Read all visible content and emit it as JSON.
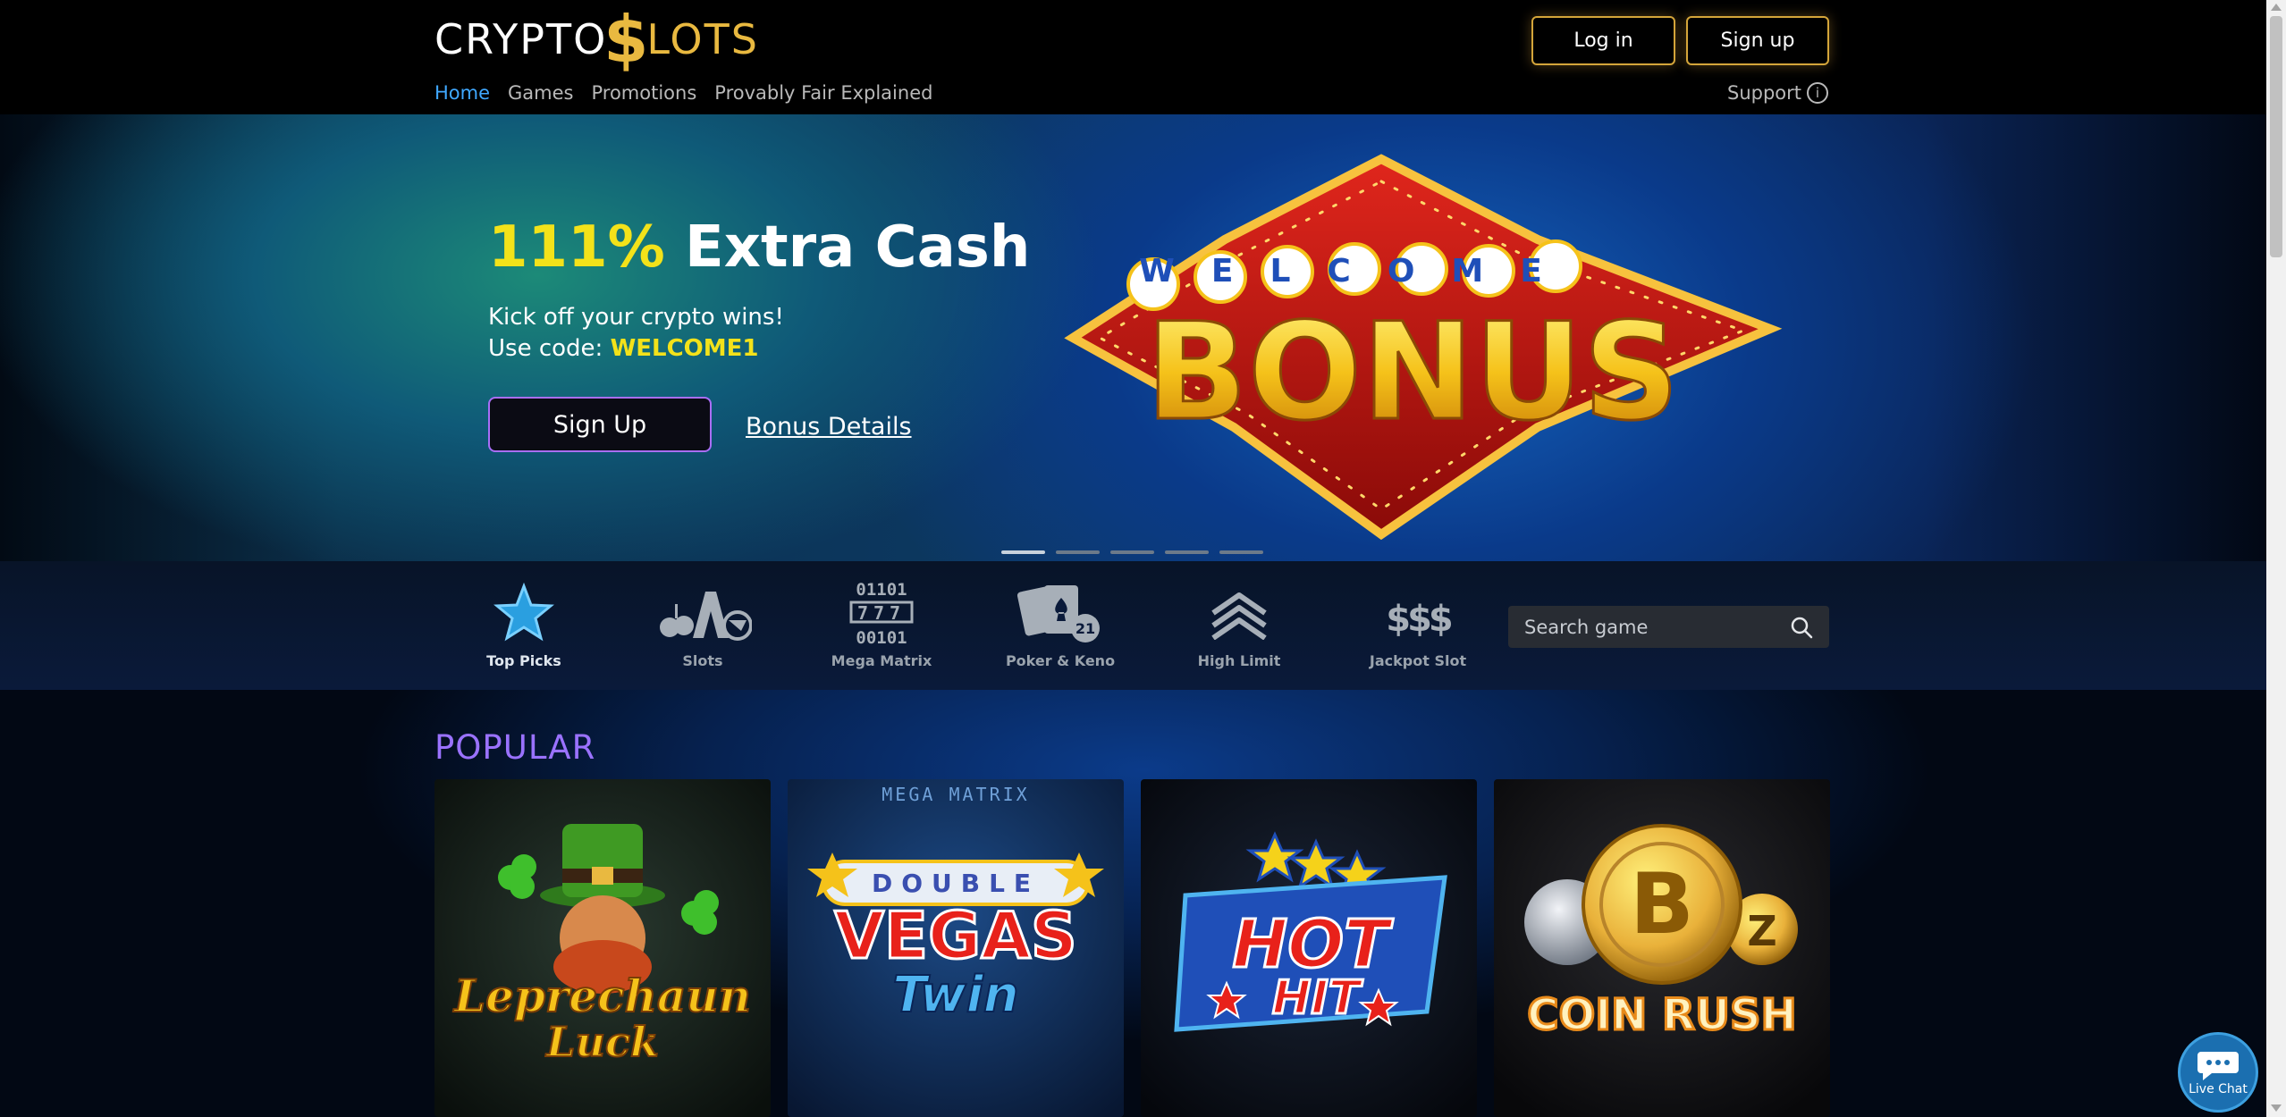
{
  "header": {
    "logo_left": "CRYPTO",
    "logo_dollar": "$",
    "logo_right": "LOTS",
    "login_label": "Log in",
    "signup_label": "Sign up",
    "nav": [
      {
        "label": "Home"
      },
      {
        "label": "Games"
      },
      {
        "label": "Promotions"
      },
      {
        "label": "Provably Fair Explained"
      }
    ],
    "support_label": "Support",
    "support_icon": "i"
  },
  "hero": {
    "title_pct": "111%",
    "title_rest": " Extra Cash",
    "line1": "Kick off your crypto wins!",
    "line2_prefix": "Use code: ",
    "code": "WELCOME1",
    "signup_label": "Sign Up",
    "details_label": "Bonus Details",
    "sign_top": "WELCOME",
    "sign_main": "BONUS",
    "slide_count": 5,
    "active_slide": 1
  },
  "categories": [
    {
      "label": "Top Picks",
      "icon": "star-icon"
    },
    {
      "label": "Slots",
      "icon": "slots-icon"
    },
    {
      "label": "Mega Matrix",
      "icon": "mega-matrix-icon",
      "glyph_lines": [
        "01101",
        "777",
        "00101"
      ]
    },
    {
      "label": "Poker & Keno",
      "icon": "cards-icon",
      "badge": "21"
    },
    {
      "label": "High Limit",
      "icon": "high-limit-icon"
    },
    {
      "label": "Jackpot Slot",
      "icon": "jackpot-icon",
      "glyph": "$$$"
    }
  ],
  "search": {
    "placeholder": "Search game"
  },
  "popular": {
    "title": "POPULAR",
    "games": [
      {
        "name": "Leprechaun Luck",
        "line1": "Leprechaun",
        "line2": "Luck"
      },
      {
        "name": "Double Vegas Twin",
        "top": "MEGA MATRIX",
        "line0": "DOUBLE",
        "line1": "VEGAS",
        "line2": "Twin"
      },
      {
        "name": "Hot Hit",
        "line1": "HOT",
        "line2": "HIT"
      },
      {
        "name": "Coin Rush",
        "line1": "COIN RUSH"
      }
    ]
  },
  "livechat": {
    "label": "Live Chat"
  }
}
